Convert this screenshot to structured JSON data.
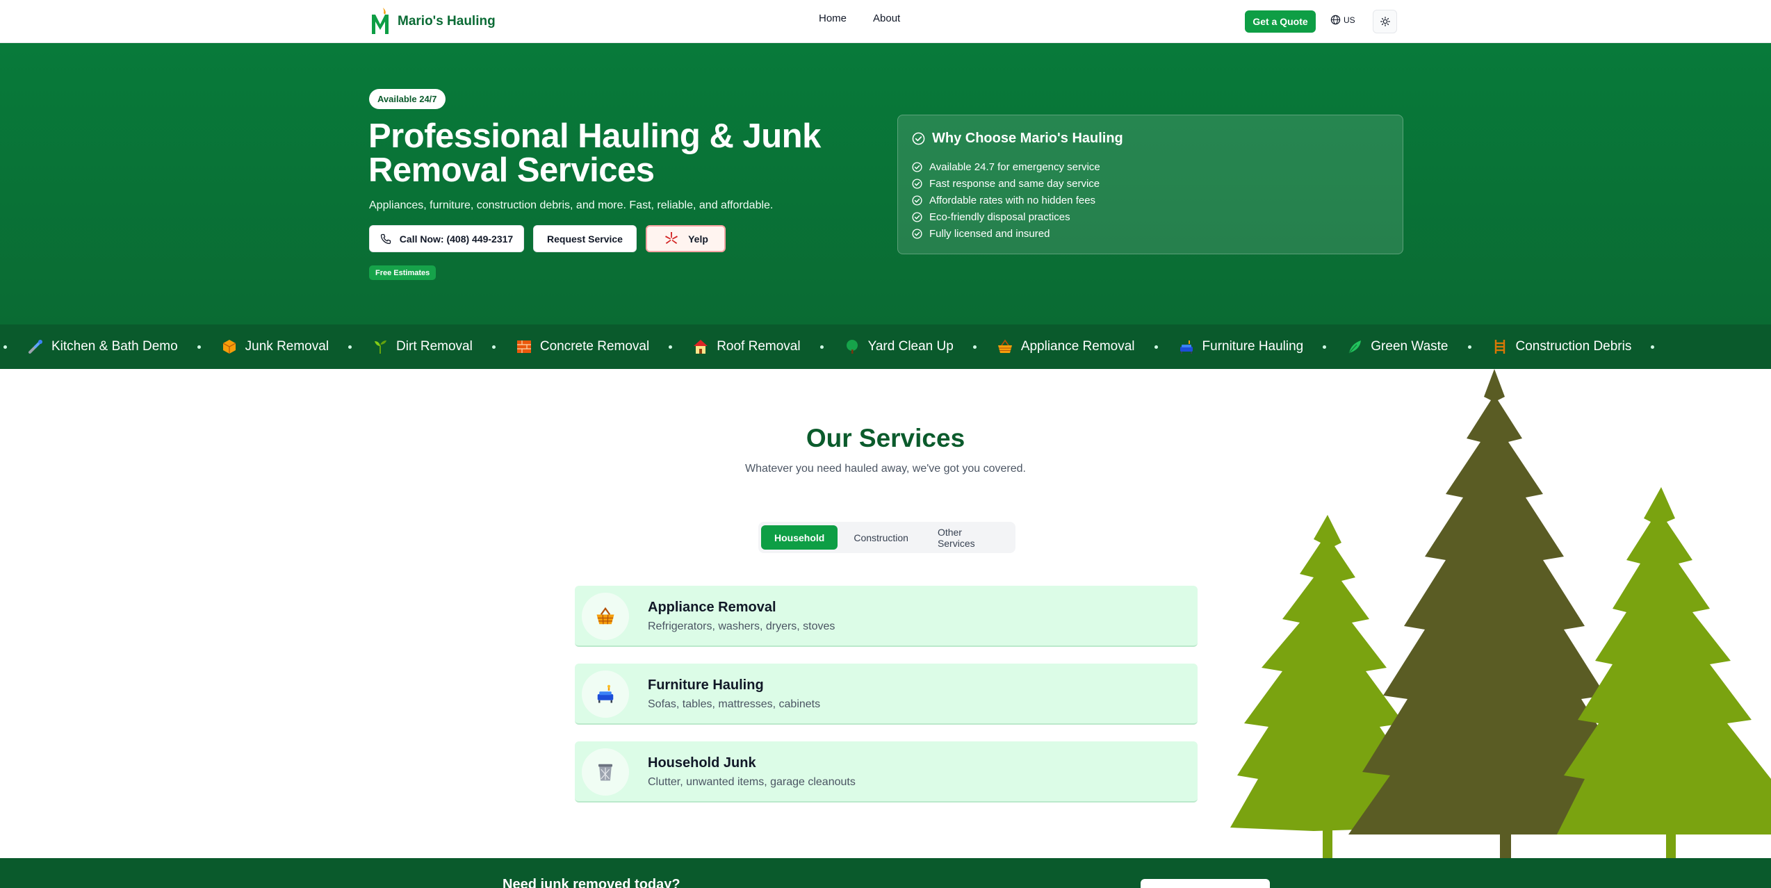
{
  "brand": {
    "letter": "M",
    "name": "Mario's Hauling"
  },
  "nav": {
    "links": [
      "Home",
      "About"
    ],
    "quote_label": "Get a Quote",
    "lang_label": "US"
  },
  "hero": {
    "badge": "Available 24/7",
    "title": "Professional Hauling & Junk Removal Services",
    "subtitle": "Appliances, furniture, construction debris, and more. Fast, reliable, and affordable.",
    "call_label": "Call Now: (408) 449-2317",
    "request_label": "Request Service",
    "yelp_label": "Yelp",
    "free_badge": "Free Estimates",
    "why_title": "Why Choose Mario's Hauling",
    "why_items": [
      "Available 24.7 for emergency service",
      "Fast response and same day service",
      "Affordable rates with no hidden fees",
      "Eco-friendly disposal practices",
      "Fully licensed and insured"
    ]
  },
  "ticker": {
    "items": [
      {
        "label": "Kitchen & Bath Demo",
        "icon": "plumbing-icon"
      },
      {
        "label": "Junk Removal",
        "icon": "box-icon"
      },
      {
        "label": "Dirt Removal",
        "icon": "sprout-icon"
      },
      {
        "label": "Concrete Removal",
        "icon": "brick-icon"
      },
      {
        "label": "Roof Removal",
        "icon": "house-icon"
      },
      {
        "label": "Yard Clean Up",
        "icon": "tree-icon"
      },
      {
        "label": "Appliance Removal",
        "icon": "basket-icon"
      },
      {
        "label": "Furniture Hauling",
        "icon": "couch-icon"
      },
      {
        "label": "Green Waste",
        "icon": "leaf-icon"
      },
      {
        "label": "Construction Debris",
        "icon": "ladder-icon"
      }
    ]
  },
  "services": {
    "title": "Our Services",
    "subtitle": "Whatever you need hauled away, we've got you covered.",
    "tabs": [
      "Household",
      "Construction",
      "Other Services"
    ],
    "active_tab": "Household",
    "cards": [
      {
        "title": "Appliance Removal",
        "desc": "Refrigerators, washers, dryers, stoves",
        "icon": "basket-icon"
      },
      {
        "title": "Furniture Hauling",
        "desc": "Sofas, tables, mattresses, cabinets",
        "icon": "couch-icon"
      },
      {
        "title": "Household Junk",
        "desc": "Clutter, unwanted items, garage cleanouts",
        "icon": "trash-icon"
      }
    ]
  },
  "cta": {
    "text": "Need junk removed today?"
  },
  "colors": {
    "primary": "#0b6b35",
    "accent": "#0e9e45",
    "ticker_bg": "#0a5a2c",
    "card_bg": "#dcfce7"
  }
}
